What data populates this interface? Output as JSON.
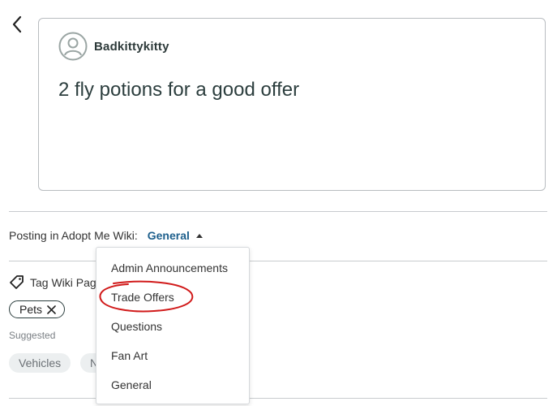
{
  "post": {
    "author": "Badkittykitty",
    "title": "2 fly potions for a good offer"
  },
  "posting": {
    "label": "Posting in Adopt Me Wiki:",
    "selected_category": "General"
  },
  "tags": {
    "label": "Tag Wiki Page",
    "chips": [
      "Pets"
    ],
    "suggested_label": "Suggested",
    "suggested": [
      "Vehicles",
      "N"
    ]
  },
  "dropdown": {
    "options": [
      "Admin Announcements",
      "Trade Offers",
      "Questions",
      "Fan Art",
      "General"
    ],
    "highlighted": "Trade Offers"
  },
  "colors": {
    "accent": "#1d5f8c",
    "annotation_circle": "#d11a1a"
  },
  "icons": [
    "chevron-left-icon",
    "user-avatar-icon",
    "caret-up-icon",
    "tag-icon",
    "close-icon"
  ]
}
